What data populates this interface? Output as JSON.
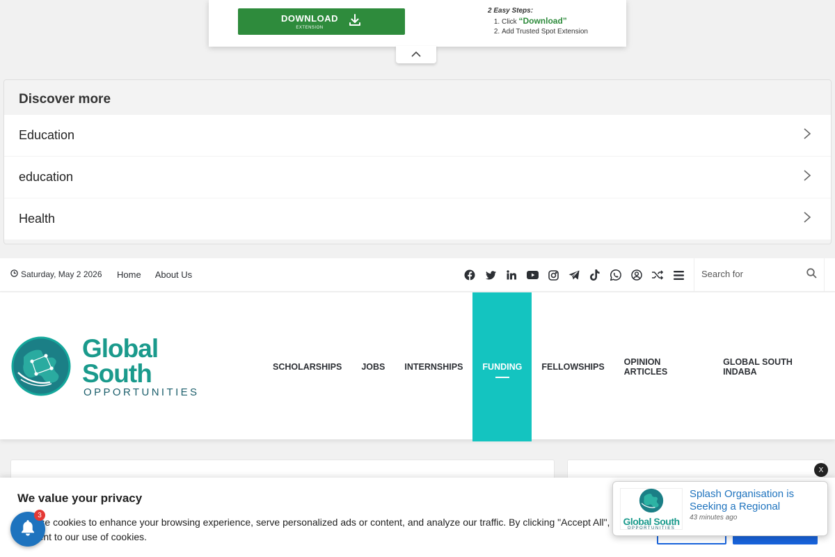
{
  "ad": {
    "button_label": "DOWNLOAD",
    "button_sublabel": "EXTENSION",
    "steps_title": "2 Easy Steps:",
    "step1_prefix": "Click ",
    "step1_highlight": "“Download”",
    "step2": "Add Trusted Spot Extension",
    "button_color": "#2e8b3c"
  },
  "discover": {
    "title": "Discover more",
    "items": [
      {
        "label": "Education"
      },
      {
        "label": "education"
      },
      {
        "label": "Health"
      }
    ]
  },
  "topbar": {
    "date": "Saturday, May 2 2026",
    "menu": [
      {
        "label": "Home"
      },
      {
        "label": "About Us"
      }
    ],
    "social_icons": [
      "facebook-icon",
      "twitter-icon",
      "linkedin-icon",
      "youtube-icon",
      "instagram-icon",
      "telegram-icon",
      "tiktok-icon",
      "whatsapp-icon",
      "login-icon",
      "random-icon",
      "sidebar-icon"
    ],
    "search_placeholder": "Search for"
  },
  "header": {
    "logo_main": "Global South",
    "logo_sub": "OPPORTUNITIES",
    "nav": [
      {
        "label": "SCHOLARSHIPS",
        "active": false
      },
      {
        "label": "JOBS",
        "active": false
      },
      {
        "label": "INTERNSHIPS",
        "active": false
      },
      {
        "label": "FUNDING",
        "active": true
      },
      {
        "label": "FELLOWSHIPS",
        "active": false
      },
      {
        "label": "OPINION ARTICLES",
        "active": false
      },
      {
        "label": "GLOBAL SOUTH INDABA",
        "active": false
      }
    ],
    "accent_color": "#14c4c0"
  },
  "cookie": {
    "title": "We value your privacy",
    "text": "We use cookies to enhance your browsing experience, serve personalized ads or content, and analyze our traffic. By clicking \"Accept All\", you consent to our use of cookies."
  },
  "notification": {
    "badge_count": "3",
    "close_label": "X",
    "title": "Splash Organisation is Seeking a Regional",
    "time": "43 minutes ago",
    "thumb_main": "Global South",
    "thumb_sub": "OPPORTUNITIES"
  }
}
